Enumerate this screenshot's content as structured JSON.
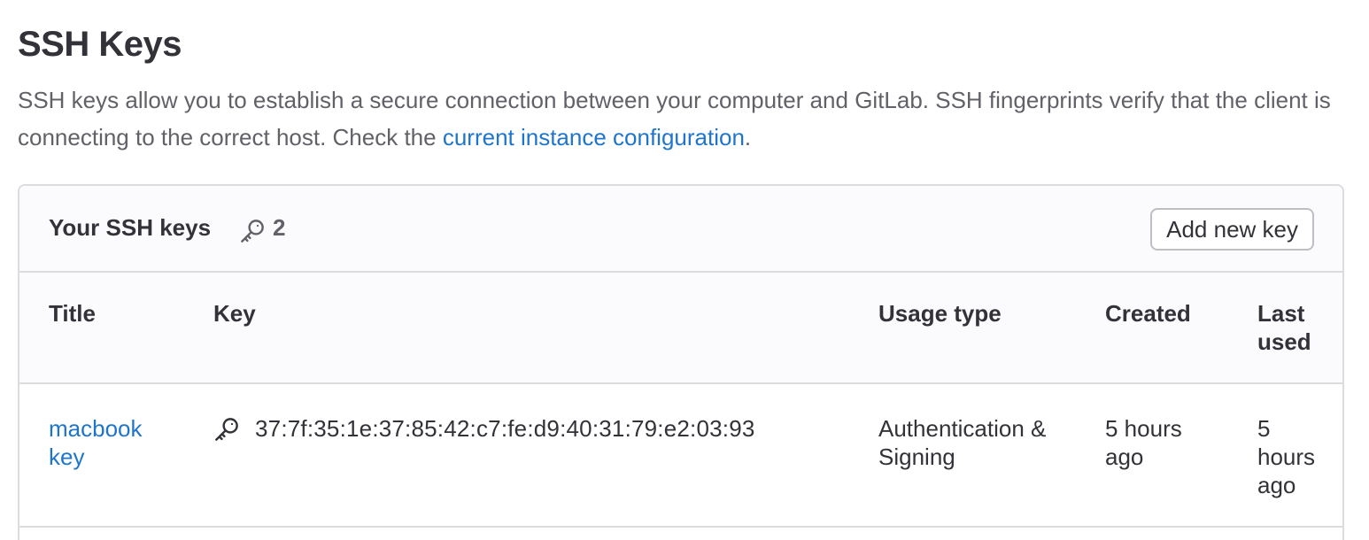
{
  "page": {
    "title": "SSH Keys",
    "description_before": "SSH keys allow you to establish a secure connection between your computer and GitLab. SSH fingerprints verify that the client is connecting to the correct host. Check the ",
    "description_link": "current instance configuration",
    "description_after": "."
  },
  "card": {
    "title": "Your SSH keys",
    "count_icon": "key-icon",
    "count": "2",
    "add_button_label": "Add new key"
  },
  "table": {
    "columns": {
      "title": "Title",
      "key": "Key",
      "usage_type": "Usage type",
      "created": "Created",
      "last_used": "Last used"
    },
    "rows": [
      {
        "title": "macbook key",
        "key_icon": "key-icon",
        "fingerprint": "37:7f:35:1e:37:85:42:c7:fe:d9:40:31:79:e2:03:93",
        "usage_type": "Authentication & Signing",
        "created": "5 hours ago",
        "last_used": "5 hours ago"
      }
    ]
  },
  "colors": {
    "link": "#1f75cb",
    "text": "#333238",
    "muted": "#626168",
    "border": "#dcdcde",
    "header_bg": "#fbfafd"
  }
}
